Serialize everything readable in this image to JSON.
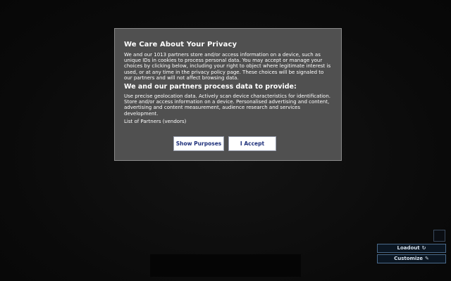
{
  "consent": {
    "title": "We Care About Your Privacy",
    "body": "We and our 1013 partners store and/or access information on a device, such as unique IDs in cookies to process personal data. You may accept or manage your choices by clicking below, including your right to object where legitimate interest is used, or at any time in the privacy policy page. These choices will be signaled to our partners and will not affect browsing data.",
    "subtitle": "We and our partners process data to provide:",
    "purposes_text": "Use precise geolocation data. Actively scan device characteristics for identification. Store and/or access information on a device. Personalised advertising and content, advertising and content measurement, audience research and services development.",
    "partners_link": "List of Partners (vendors)",
    "show_purposes_label": "Show Purposes",
    "accept_label": "I Accept"
  },
  "game_ui": {
    "loadout_label": "Loadout",
    "loadout_icon": "refresh-icon",
    "customize_label": "Customize",
    "customize_icon": "pencil-icon"
  },
  "colors": {
    "modal_bg": "#505050",
    "button_text": "#1d2f7a",
    "side_button_border": "#4a6a8a"
  }
}
